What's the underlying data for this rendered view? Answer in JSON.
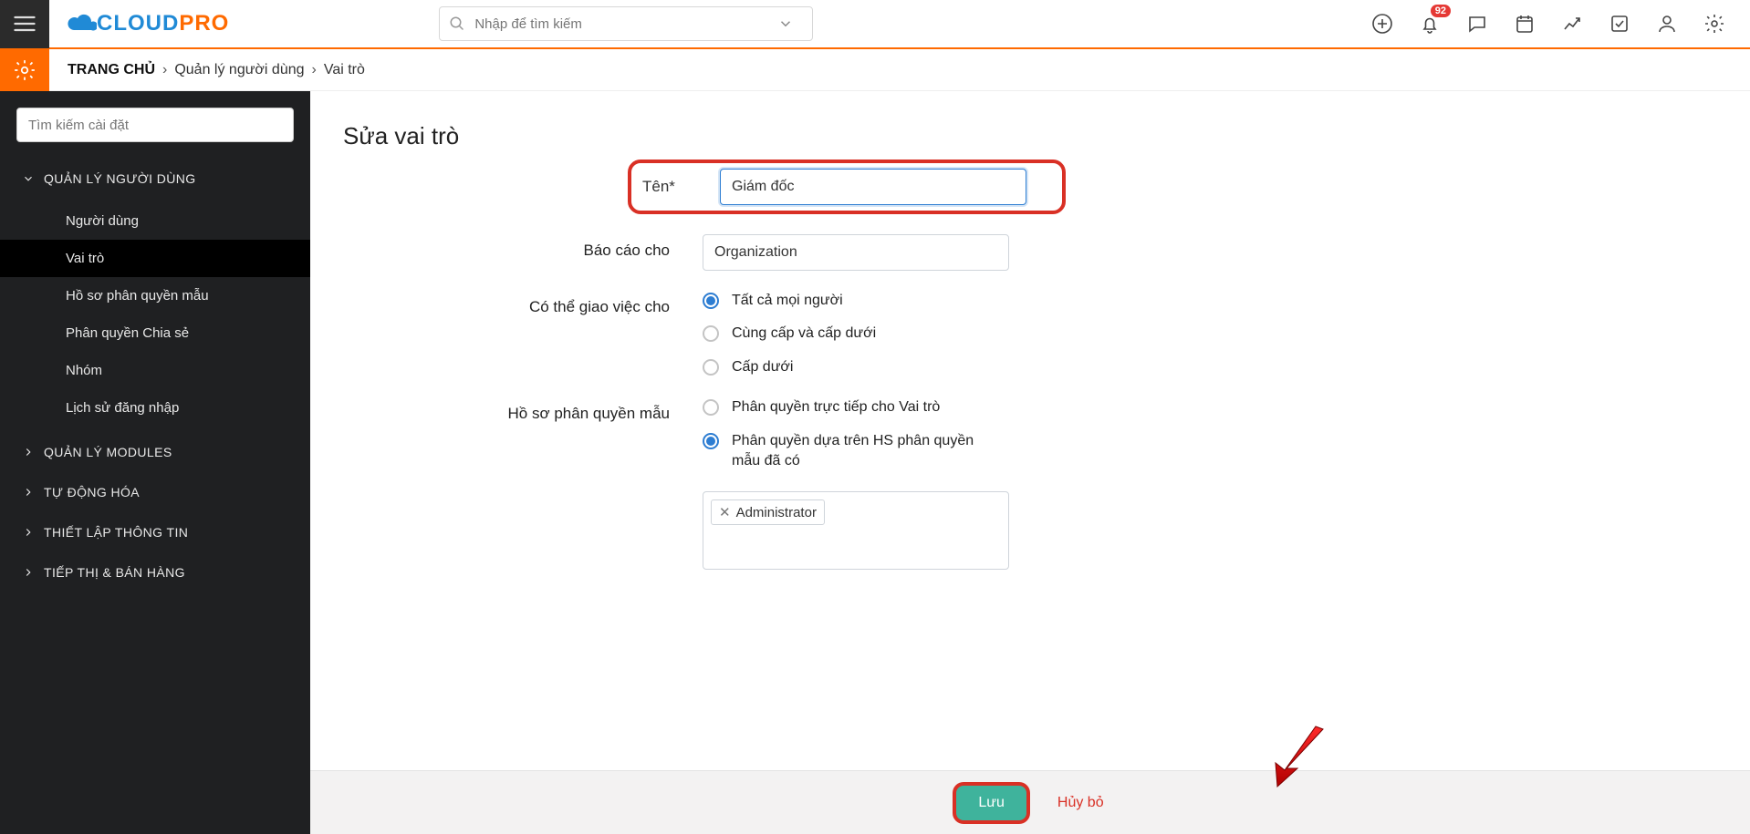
{
  "logo": {
    "part1": "CLOUD",
    "part2": "PRO"
  },
  "top_search": {
    "placeholder": "Nhập để tìm kiếm"
  },
  "notifications_badge": "92",
  "breadcrumb": {
    "home": "TRANG CHỦ",
    "mid": "Quản lý người dùng",
    "last": "Vai trò"
  },
  "sidebar": {
    "search_placeholder": "Tìm kiếm cài đặt",
    "sections": [
      {
        "label": "QUẢN LÝ NGƯỜI DÙNG",
        "expanded": true,
        "items": [
          {
            "label": "Người dùng"
          },
          {
            "label": "Vai trò",
            "active": true
          },
          {
            "label": "Hồ sơ phân quyền mẫu"
          },
          {
            "label": "Phân quyền Chia sẻ"
          },
          {
            "label": "Nhóm"
          },
          {
            "label": "Lịch sử đăng nhập"
          }
        ]
      },
      {
        "label": "QUẢN LÝ MODULES",
        "expanded": false
      },
      {
        "label": "TỰ ĐỘNG HÓA",
        "expanded": false
      },
      {
        "label": "THIẾT LẬP THÔNG TIN",
        "expanded": false
      },
      {
        "label": "TIẾP THỊ & BÁN HÀNG",
        "expanded": false
      }
    ]
  },
  "form": {
    "title": "Sửa vai trò",
    "name_label": "Tên",
    "name_value": "Giám đốc",
    "report_label": "Báo cáo cho",
    "report_value": "Organization",
    "assign_label": "Có thể giao việc cho",
    "assign_options": [
      {
        "label": "Tất cả mọi người",
        "checked": true
      },
      {
        "label": "Cùng cấp và cấp dưới",
        "checked": false
      },
      {
        "label": "Cấp dưới",
        "checked": false
      }
    ],
    "profile_label": "Hồ sơ phân quyền mẫu",
    "profile_options": [
      {
        "label": "Phân quyền trực tiếp cho Vai trò",
        "checked": false
      },
      {
        "label": "Phân quyền dựa trên HS phân quyền mẫu đã có",
        "checked": true
      }
    ],
    "tag": "Administrator"
  },
  "buttons": {
    "save": "Lưu",
    "cancel": "Hủy bỏ"
  }
}
